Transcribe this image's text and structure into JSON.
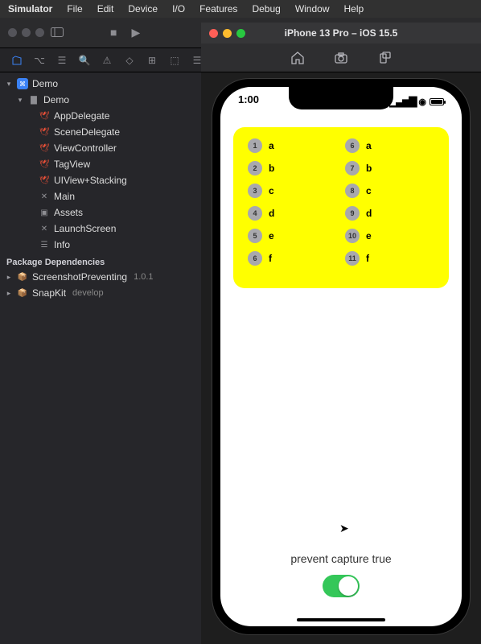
{
  "menubar": {
    "app": "Simulator",
    "items": [
      "File",
      "Edit",
      "Device",
      "I/O",
      "Features",
      "Debug",
      "Window",
      "Help"
    ]
  },
  "sim_title": "iPhone 13 Pro – iOS 15.5",
  "statusbar_time": "1:00",
  "sidebar": {
    "project": "Demo",
    "group": "Demo",
    "files": [
      "AppDelegate",
      "SceneDelegate",
      "ViewController",
      "TagView",
      "UIView+Stacking",
      "Main",
      "Assets",
      "LaunchScreen",
      "Info"
    ],
    "file_kinds": [
      "swift",
      "swift",
      "swift",
      "swift",
      "swift",
      "xib",
      "assets",
      "xib",
      "plist"
    ],
    "deps_header": "Package Dependencies",
    "packages": [
      {
        "name": "ScreenshotPreventing",
        "ver": "1.0.1"
      },
      {
        "name": "SnapKit",
        "ver": "develop"
      }
    ]
  },
  "tags": {
    "left": [
      {
        "n": "1",
        "t": "a"
      },
      {
        "n": "2",
        "t": "b"
      },
      {
        "n": "3",
        "t": "c"
      },
      {
        "n": "4",
        "t": "d"
      },
      {
        "n": "5",
        "t": "e"
      },
      {
        "n": "6",
        "t": "f"
      }
    ],
    "right": [
      {
        "n": "6",
        "t": "a"
      },
      {
        "n": "7",
        "t": "b"
      },
      {
        "n": "8",
        "t": "c"
      },
      {
        "n": "9",
        "t": "d"
      },
      {
        "n": "10",
        "t": "e"
      },
      {
        "n": "11",
        "t": "f"
      }
    ]
  },
  "capture_label": "prevent capture true"
}
